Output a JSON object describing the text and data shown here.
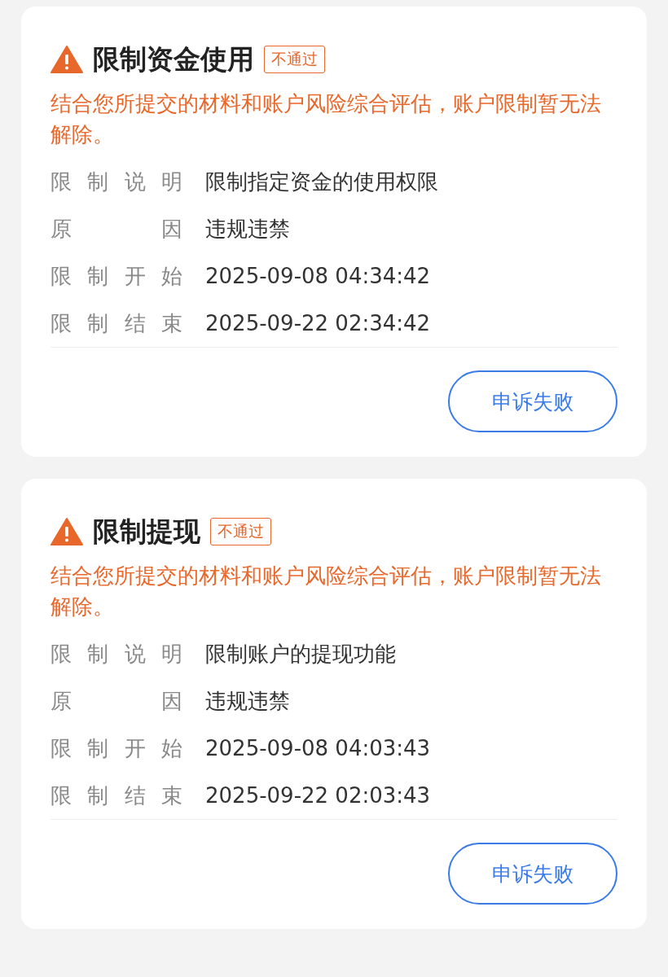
{
  "cards": [
    {
      "title": "限制资金使用",
      "status": "不通过",
      "description": "结合您所提交的材料和账户风险综合评估，账户限制暂无法解除。",
      "details": [
        {
          "label": "限制说明",
          "value": "限制指定资金的使用权限"
        },
        {
          "label": "原因",
          "value": "违规违禁"
        },
        {
          "label": "限制开始",
          "value": "2025-09-08 04:34:42"
        },
        {
          "label": "限制结束",
          "value": "2025-09-22 02:34:42"
        }
      ],
      "button": "申诉失败"
    },
    {
      "title": "限制提现",
      "status": "不通过",
      "description": "结合您所提交的材料和账户风险综合评估，账户限制暂无法解除。",
      "details": [
        {
          "label": "限制说明",
          "value": "限制账户的提现功能"
        },
        {
          "label": "原因",
          "value": "违规违禁"
        },
        {
          "label": "限制开始",
          "value": "2025-09-08 04:03:43"
        },
        {
          "label": "限制结束",
          "value": "2025-09-22 02:03:43"
        }
      ],
      "button": "申诉失败"
    }
  ]
}
